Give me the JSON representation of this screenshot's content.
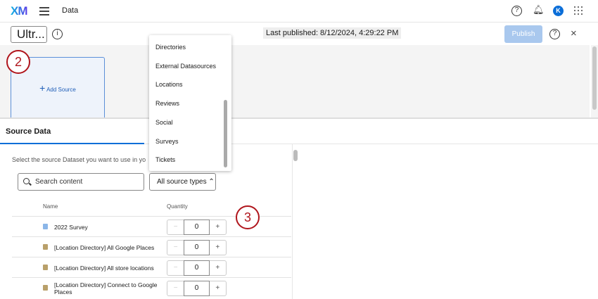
{
  "header": {
    "logo": "XM",
    "section": "Data",
    "avatar_initial": "K"
  },
  "toolbar": {
    "title": "Ultr...",
    "last_published": "Last published: 8/12/2024, 4:29:22 PM",
    "publish": "Publish"
  },
  "canvas": {
    "add_source": "Add Source",
    "step_badge": "2"
  },
  "source_panel": {
    "tab": "Source Data",
    "instruction": "Select the source Dataset you want to use in yo",
    "search_placeholder": "Search content",
    "type_filter": "All source types",
    "columns": {
      "name": "Name",
      "quantity": "Quantity"
    },
    "step_badge": "3",
    "rows": [
      {
        "name": "2022 Survey",
        "type": "survey",
        "quantity": "0"
      },
      {
        "name": "[Location Directory] All Google Places",
        "type": "location",
        "quantity": "0"
      },
      {
        "name": "[Location Directory] All store locations",
        "type": "location",
        "quantity": "0"
      },
      {
        "name": "[Location Directory] Connect to Google Places",
        "type": "location",
        "quantity": "0"
      }
    ],
    "minus": "−",
    "plus": "+"
  },
  "dropdown": {
    "options": [
      "Directories",
      "External Datasources",
      "Locations",
      "Reviews",
      "Social",
      "Surveys",
      "Tickets"
    ]
  },
  "colors": {
    "accent": "#0b6ed8",
    "badge": "#b0151c",
    "survey_icon": "#8bb6e8",
    "location_icon": "#b9a06a"
  }
}
